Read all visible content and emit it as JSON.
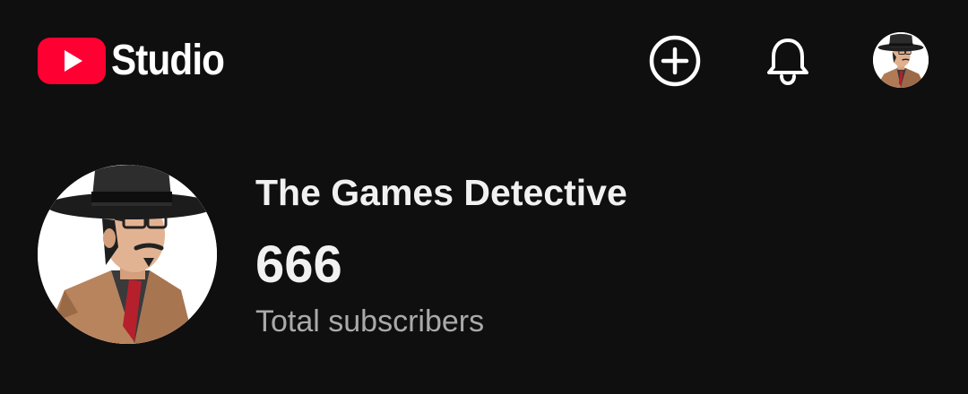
{
  "header": {
    "logo": {
      "icon": "youtube-play-icon",
      "text": "Studio",
      "brand_color": "#ff0033"
    },
    "actions": {
      "create_icon": "plus-circle-icon",
      "notifications_icon": "bell-icon",
      "account_icon": "avatar"
    }
  },
  "channel": {
    "name": "The Games Detective",
    "subscriber_count": "666",
    "subscriber_label": "Total subscribers"
  },
  "colors": {
    "background": "#0f0f0f",
    "text_primary": "#f1f1f1",
    "text_secondary": "#aaaaaa"
  }
}
